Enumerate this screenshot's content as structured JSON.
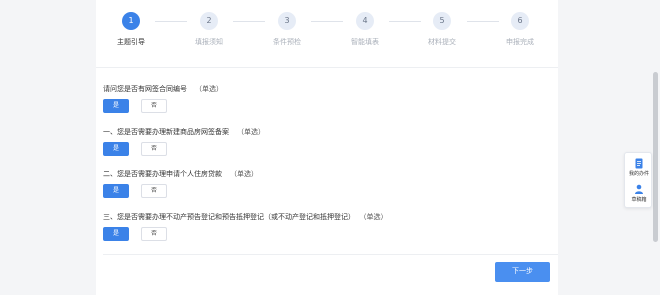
{
  "steps": [
    {
      "num": "1",
      "label": "主题引导",
      "active": true
    },
    {
      "num": "2",
      "label": "填报须知",
      "active": false
    },
    {
      "num": "3",
      "label": "条件预检",
      "active": false
    },
    {
      "num": "4",
      "label": "智能填表",
      "active": false
    },
    {
      "num": "5",
      "label": "材料提交",
      "active": false
    },
    {
      "num": "6",
      "label": "申报完成",
      "active": false
    }
  ],
  "questions": [
    {
      "title": "请问您是否有网签合同编号",
      "tag": "（单选）",
      "options": [
        "是",
        "否"
      ],
      "selected": "是"
    },
    {
      "title": "一、您是否需要办理新建商品房网签备案",
      "tag": "（单选）",
      "options": [
        "是",
        "否"
      ],
      "selected": "是"
    },
    {
      "title": "二、您是否需要办理申请个人住房贷款",
      "tag": "（单选）",
      "options": [
        "是",
        "否"
      ],
      "selected": "是"
    },
    {
      "title": "三、您是否需要办理不动产预告登记和预告抵押登记（或不动产登记和抵押登记）",
      "tag": "（单选）",
      "options": [
        "是",
        "否"
      ],
      "selected": "是"
    }
  ],
  "next_button": "下一步",
  "float_panel": {
    "my_items": "我的办件",
    "drafts": "草稿箱"
  },
  "colors": {
    "accent": "#3b82e8",
    "button": "#4a8ff0",
    "background": "#f4f5f7"
  }
}
